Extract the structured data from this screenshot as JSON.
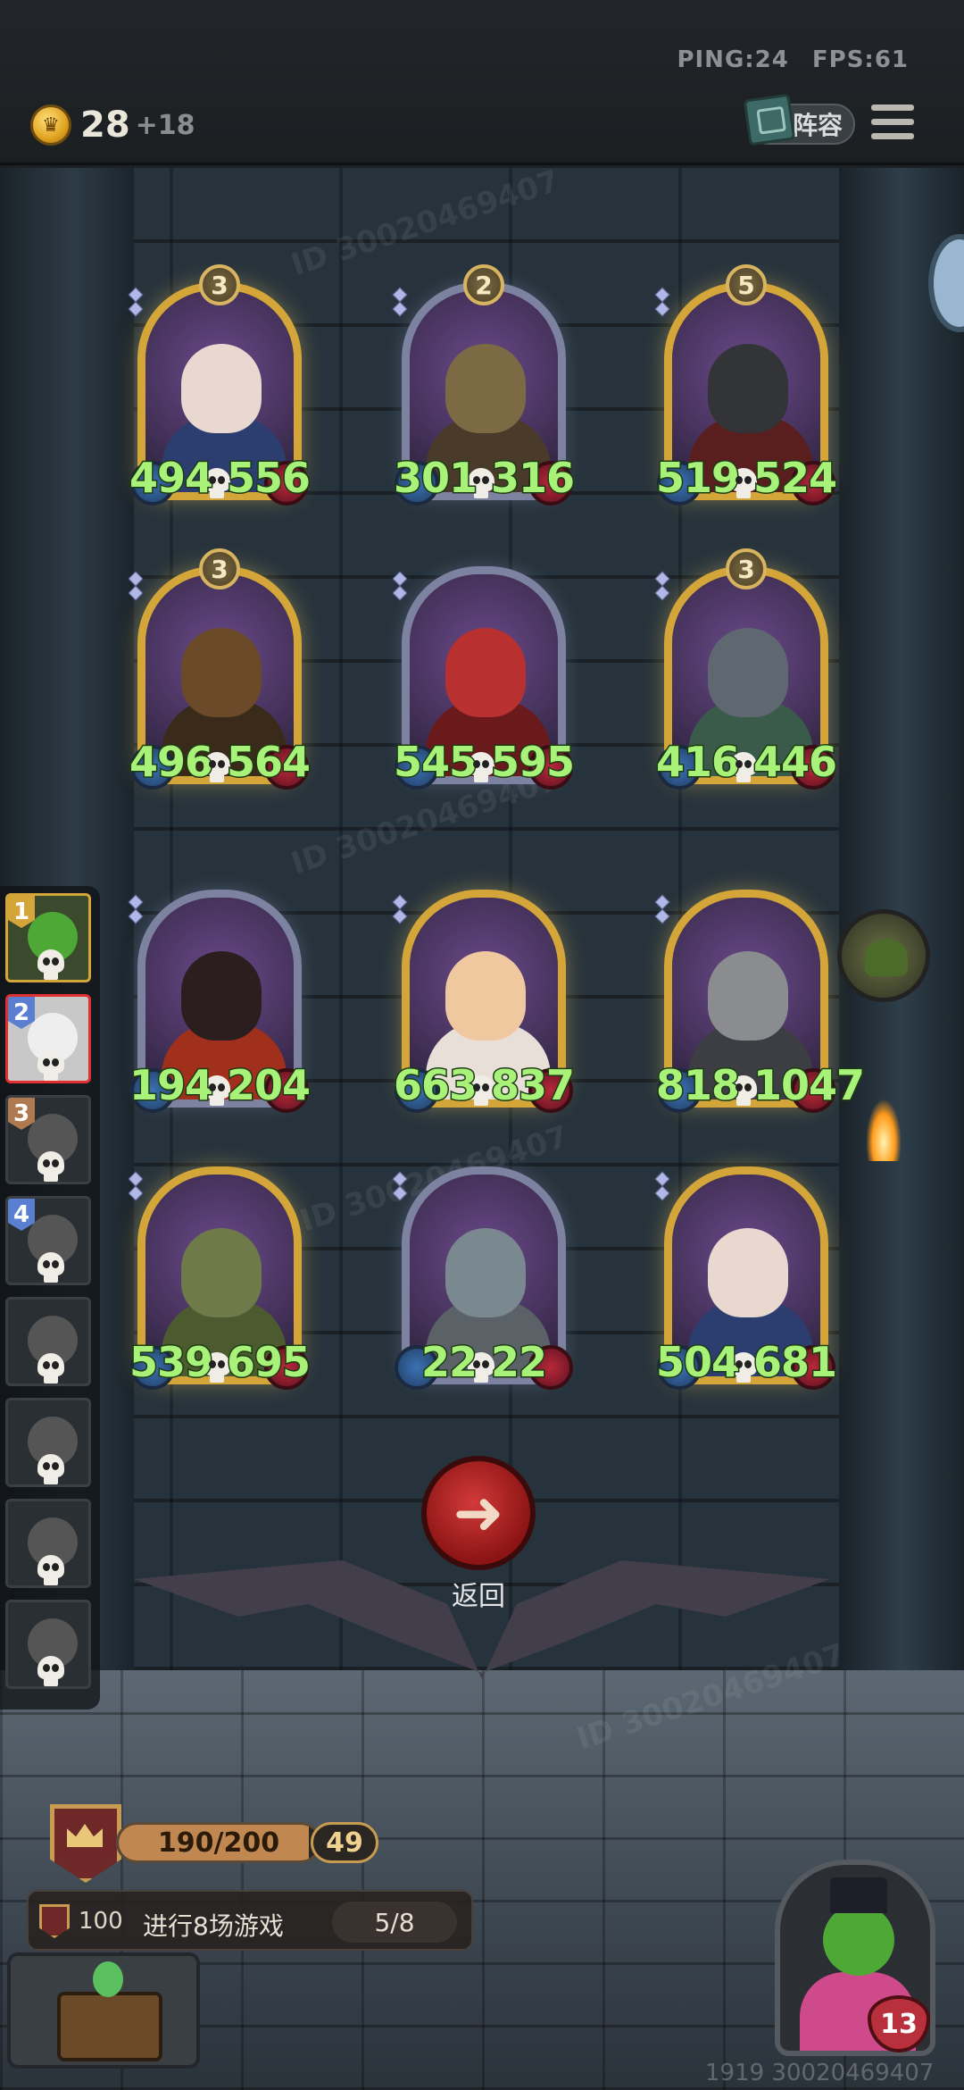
{
  "status": {
    "ping": "PING:24",
    "fps": "FPS:61"
  },
  "gold": {
    "value": "28",
    "income": "+18"
  },
  "lineup_button": "阵容",
  "watermark": "ID 30020469407",
  "cards": [
    {
      "tier": "3",
      "attack": "494",
      "health": "556",
      "frame": "gold",
      "head": "#e8d8cf",
      "body": "#2c3e70"
    },
    {
      "tier": "2",
      "attack": "301",
      "health": "316",
      "frame": "silver",
      "head": "#7b6a44",
      "body": "#4a3a2a"
    },
    {
      "tier": "5",
      "attack": "519",
      "health": "524",
      "frame": "gold",
      "head": "#333438",
      "body": "#5b1e1e"
    },
    {
      "tier": "3",
      "attack": "496",
      "health": "564",
      "frame": "gold",
      "head": "#6b4a2a",
      "body": "#3a2a1a"
    },
    {
      "tier": "",
      "attack": "545",
      "health": "595",
      "frame": "silver",
      "head": "#b83030",
      "body": "#6a1a1a"
    },
    {
      "tier": "3",
      "attack": "416",
      "health": "446",
      "frame": "gold",
      "head": "#5f6770",
      "body": "#3a5a4a"
    },
    {
      "tier": "",
      "attack": "194",
      "health": "204",
      "frame": "silver",
      "head": "#2a1e1e",
      "body": "#a0301c"
    },
    {
      "tier": "",
      "attack": "663",
      "health": "837",
      "frame": "gold",
      "head": "#f0c8a0",
      "body": "#e8e0d8"
    },
    {
      "tier": "",
      "attack": "818",
      "health": "1047",
      "frame": "gold",
      "head": "#8a8c90",
      "body": "#3c3e44"
    },
    {
      "tier": "",
      "attack": "539",
      "health": "695",
      "frame": "gold",
      "head": "#6e7a4a",
      "body": "#4c5a30"
    },
    {
      "tier": "",
      "attack": "22",
      "health": "22",
      "frame": "silver",
      "head": "#7a8890",
      "body": "#5a6268"
    },
    {
      "tier": "",
      "attack": "504",
      "health": "681",
      "frame": "gold",
      "head": "#e8d8cf",
      "body": "#2c3e70"
    }
  ],
  "roster": [
    {
      "rank": "1",
      "rank_color": "#d4a63a"
    },
    {
      "rank": "2",
      "rank_color": "#5a7fd0"
    },
    {
      "rank": "3",
      "rank_color": "#b07a50"
    },
    {
      "rank": "4",
      "rank_color": "#5a7fd0"
    },
    {
      "rank": "",
      "rank_color": ""
    },
    {
      "rank": "",
      "rank_color": ""
    },
    {
      "rank": "",
      "rank_color": ""
    },
    {
      "rank": "",
      "rank_color": ""
    }
  ],
  "back_button": {
    "icon": "arrow-left",
    "label": "返回"
  },
  "xp": {
    "text": "190/200",
    "fraction": 0.95,
    "level": "49"
  },
  "quest": {
    "points": "100",
    "text": "进行8场游戏",
    "progress": "5/8"
  },
  "hero": {
    "health": "13"
  },
  "footer_id": "1919 30020469407"
}
